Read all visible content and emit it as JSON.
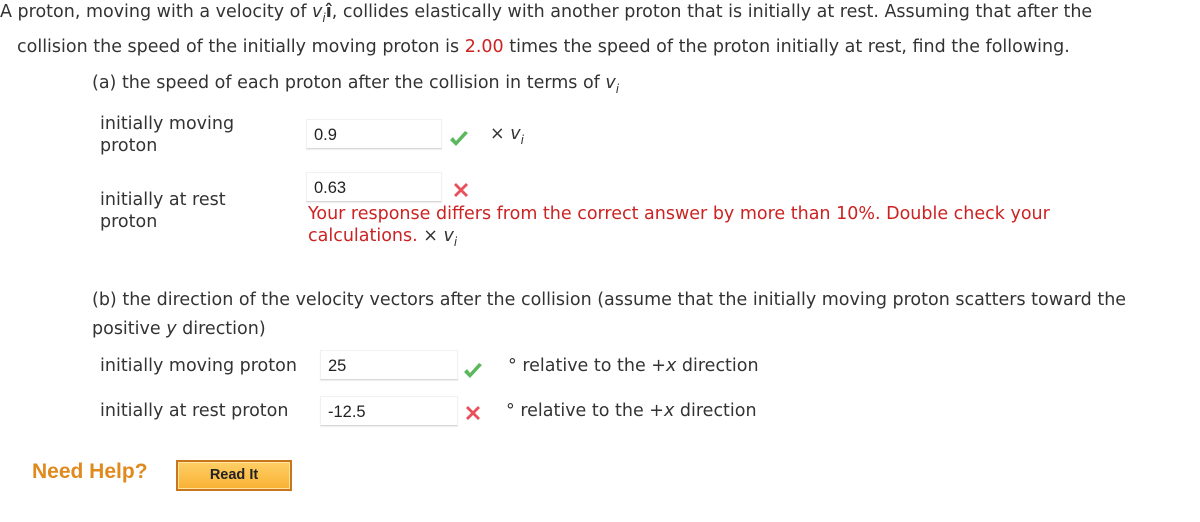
{
  "problem": {
    "line1_a": "A proton, moving with a velocity of ",
    "line1_var": "v",
    "line1_sub": "i",
    "line1_unit": "î",
    "line1_b": ", collides elastically with another proton that is initially at rest. Assuming that after the",
    "line2_a": "collision the speed of the initially moving proton is ",
    "line2_value": "2.00",
    "line2_b": " times the speed of the proton initially at rest, find the following."
  },
  "part_a": {
    "prompt": "(a) the speed of each proton after the collision in terms of ",
    "prompt_var": "v",
    "prompt_sub": "i",
    "rows": [
      {
        "label_line1": "initially moving",
        "label_line2": "proton",
        "value": "0.9",
        "status": "correct",
        "unit_prefix": "× ",
        "unit_var": "v",
        "unit_sub": "i"
      },
      {
        "label_line1": "initially at rest",
        "label_line2": "proton",
        "value": "0.63",
        "status": "incorrect",
        "feedback_line1": "Your response differs from the correct answer by more than 10%. Double check your",
        "feedback_line2": "calculations.",
        "unit_prefix": " × ",
        "unit_var": "v",
        "unit_sub": "i"
      }
    ]
  },
  "part_b": {
    "prompt_line1": "(b) the direction of the velocity vectors after the collision (assume that the initially moving proton scatters toward the",
    "prompt_line2_a": "positive ",
    "prompt_line2_var": "y",
    "prompt_line2_b": " direction)",
    "rows": [
      {
        "label": "initially moving proton",
        "value": "25",
        "status": "correct",
        "unit_a": "° relative to the +",
        "unit_var": "x",
        "unit_b": " direction"
      },
      {
        "label": "initially at rest proton",
        "value": "-12.5",
        "status": "incorrect",
        "unit_a": "° relative to the +",
        "unit_var": "x",
        "unit_b": " direction"
      }
    ]
  },
  "help": {
    "title": "Need Help?",
    "read_it_label": "Read It"
  },
  "colors": {
    "accent_red": "#cc2222",
    "correct_green": "#5cb85c",
    "incorrect_red": "#e8505b",
    "help_orange": "#e08a1e"
  }
}
